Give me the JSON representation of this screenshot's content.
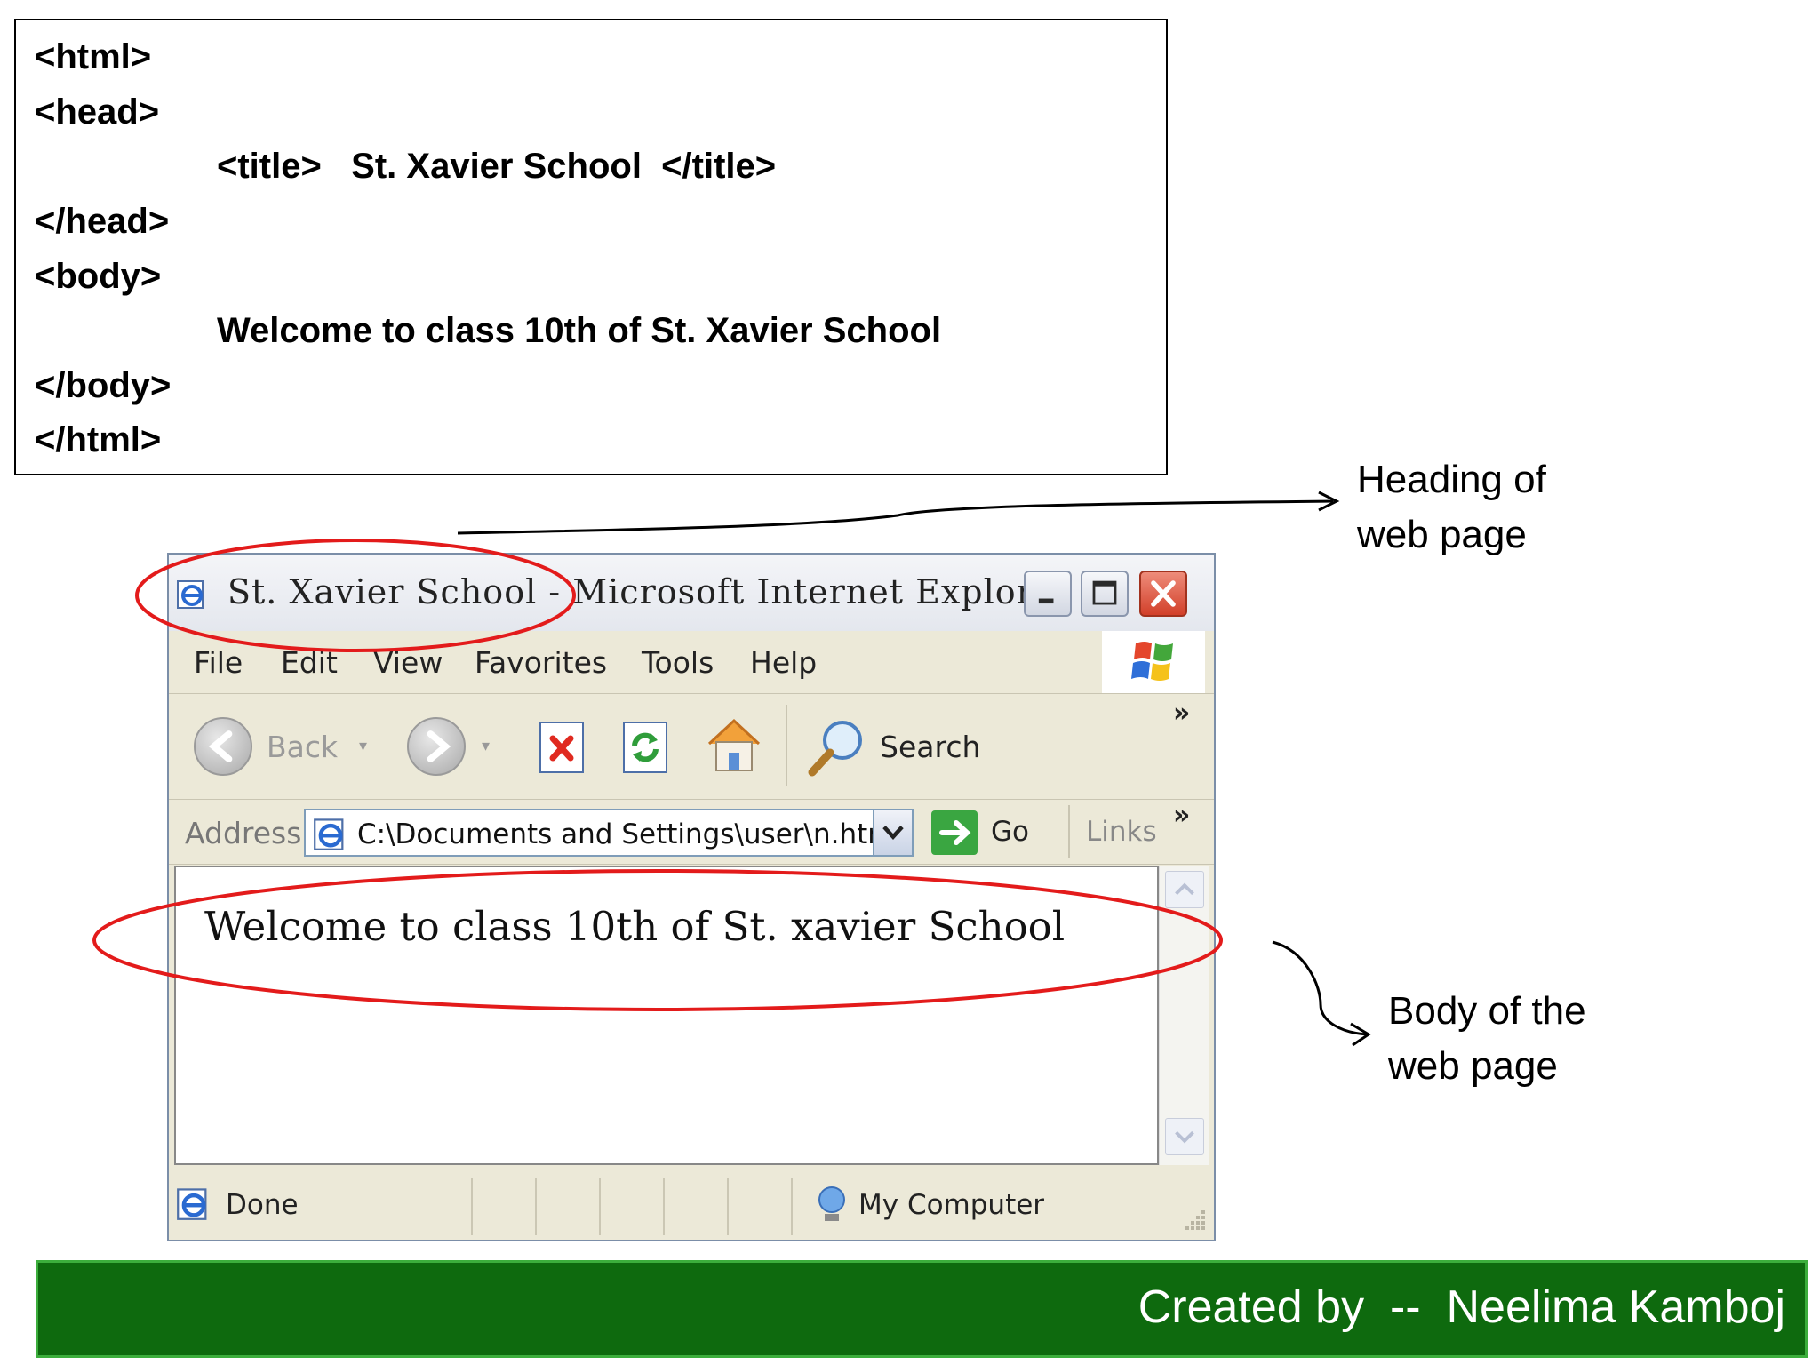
{
  "code_box": {
    "lines": [
      "<html>",
      "<head>",
      "<title>   St. Xavier School  </title>",
      "</head>",
      "<body>",
      "Welcome to class 10th of St. Xavier School",
      "</body>",
      "</html>"
    ]
  },
  "annotations": {
    "heading_line1": "Heading of",
    "heading_line2": "web page",
    "body_line1": "Body of the",
    "body_line2": "web page",
    "highlight_color": "#e31b1b"
  },
  "browser": {
    "title": "St. Xavier School - Microsoft Internet Explorer",
    "menu": [
      "File",
      "Edit",
      "View",
      "Favorites",
      "Tools",
      "Help"
    ],
    "toolbar": {
      "back_label": "Back",
      "search_label": "Search",
      "overflow_label": "»"
    },
    "address": {
      "label": "Address",
      "value": "C:\\Documents and Settings\\user\\n.htm",
      "go_label": "Go",
      "links_label": "Links"
    },
    "content_text": "Welcome to class 10th of St. xavier School",
    "status": {
      "left": "Done",
      "right": "My Computer"
    }
  },
  "footer": {
    "text": "Created by  --  Neelima Kamboj",
    "bg_color": "#0e6a0e"
  }
}
